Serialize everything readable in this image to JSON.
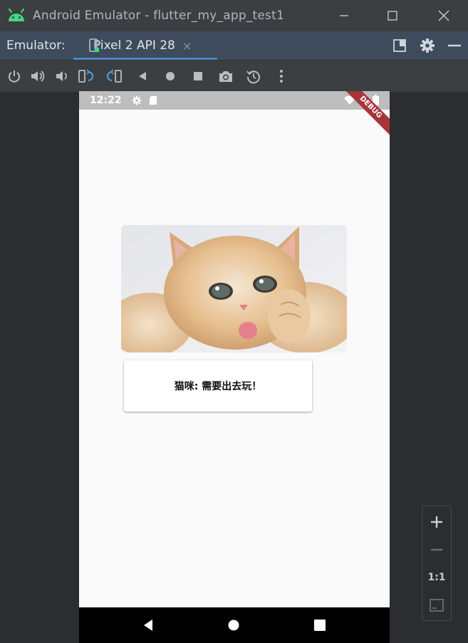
{
  "window": {
    "title": "Android Emulator - flutter_my_app_test1",
    "android_color": "#3ddc84"
  },
  "tabbar": {
    "label": "Emulator:",
    "tab_name": "Pixel 2 API 28",
    "tab_close": "×"
  },
  "toolbar": {
    "icons": [
      "power-icon",
      "volume-up-icon",
      "volume-down-icon",
      "rotate-left-icon",
      "rotate-right-icon",
      "back-icon",
      "home-icon",
      "overview-icon",
      "screenshot-icon",
      "snapshot-icon",
      "more-icon"
    ]
  },
  "device": {
    "status_time": "12:22",
    "debug_label": "DEBUG",
    "card_text": "猫咪: 需要出去玩！"
  },
  "zoom": {
    "plus": "+",
    "minus": "−",
    "one_to_one": "1:1"
  },
  "colors": {
    "accent": "#4a88c7",
    "debug_banner": "#a8343a",
    "status_bar": "#bdbdbd"
  }
}
